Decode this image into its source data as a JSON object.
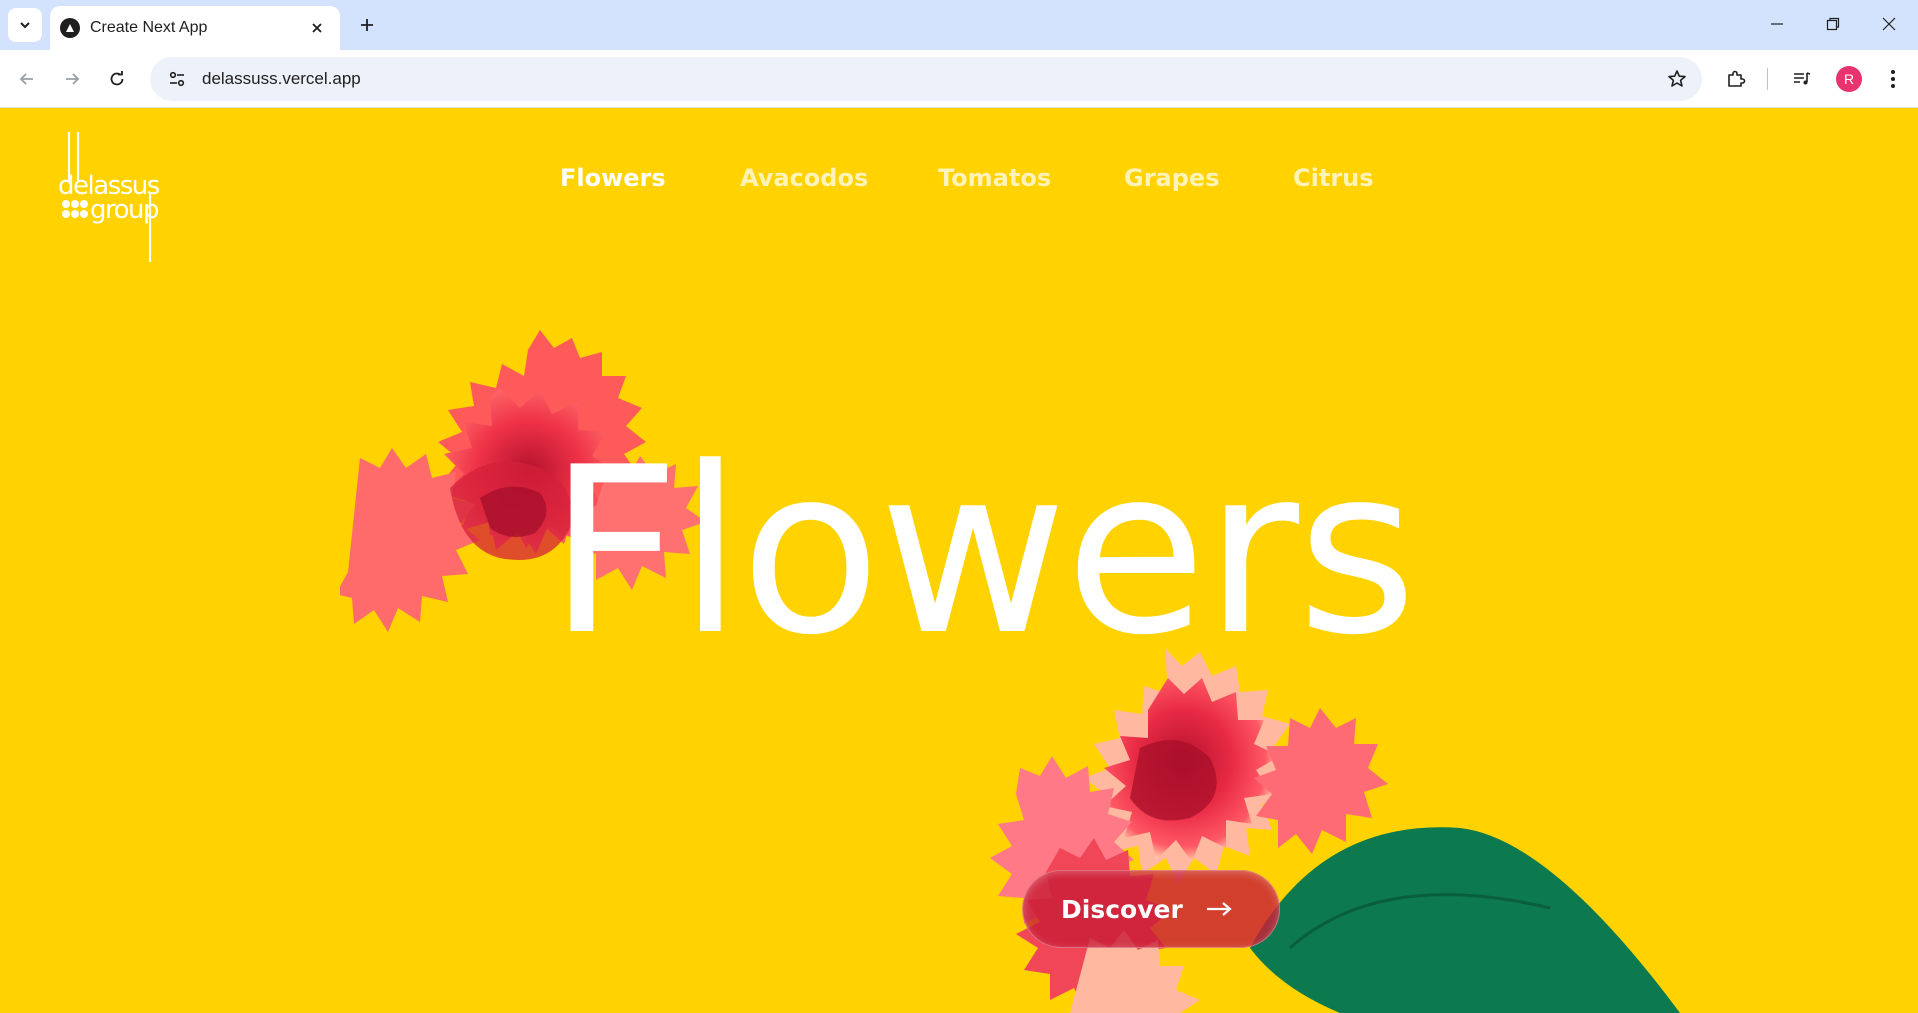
{
  "browser": {
    "tab_title": "Create Next App",
    "url": "delassuss.vercel.app",
    "profile_initial": "R"
  },
  "site": {
    "logo_text": "delassus group",
    "nav": [
      {
        "label": "Flowers",
        "active": true
      },
      {
        "label": "Avacodos",
        "active": false
      },
      {
        "label": "Tomatos",
        "active": false
      },
      {
        "label": "Grapes",
        "active": false
      },
      {
        "label": "Citrus",
        "active": false
      }
    ],
    "hero_title": "Flowers",
    "cta_label": "Discover",
    "colors": {
      "background": "#ffd200",
      "flower_red": "#f0334a",
      "leaf_green": "#0c7a4e",
      "text": "#ffffff"
    }
  }
}
